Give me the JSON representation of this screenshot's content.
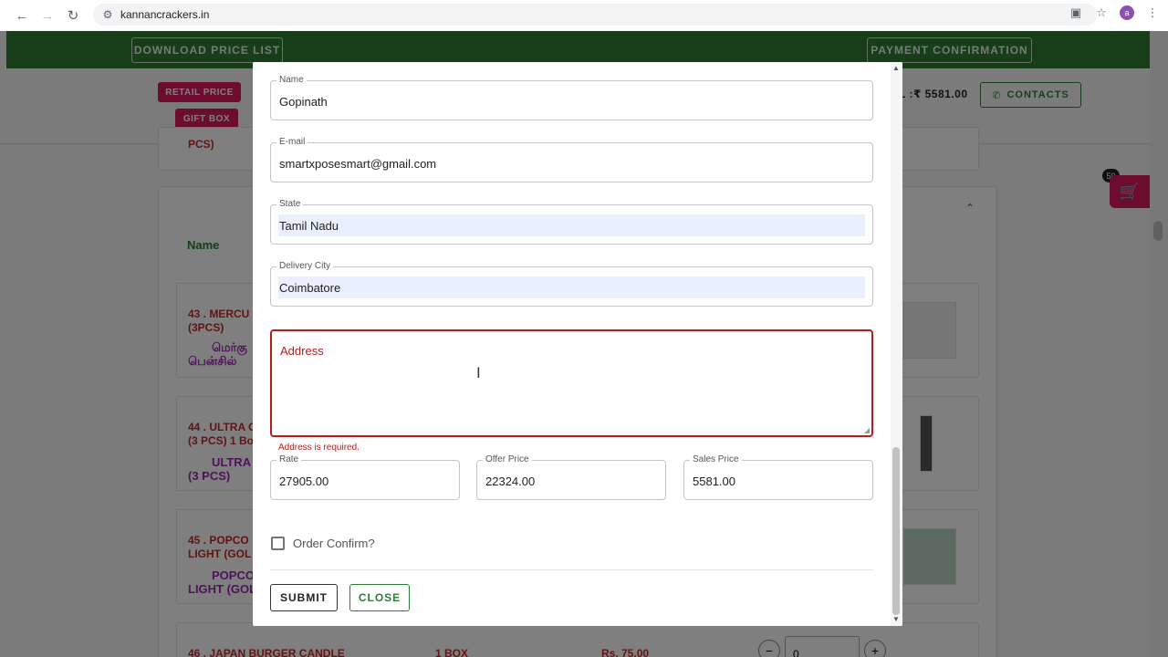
{
  "browser": {
    "url": "kannancrackers.in",
    "profile_initial": "a"
  },
  "page": {
    "download_price_list": "DOWNLOAD PRICE LIST",
    "payment_confirmation": "PAYMENT CONFIRMATION",
    "retail_price": "RETAIL PRICE",
    "gift_box": "GIFT BOX",
    "total_partial": "L :₹ 5581.00",
    "contacts": "CONTACTS",
    "column_name": "Name",
    "cart_count": "59",
    "partial_prev": "PCS)",
    "products": [
      {
        "name": "43 . MERCU\n(3PCS)",
        "tamil": "மெர்கு\nபென்சில்"
      },
      {
        "name": "44 . ULTRA C\n(3 PCS) 1 Bo",
        "tamil": "ULTRA C\n(3 PCS)"
      },
      {
        "name": "45 . POPCO\nLIGHT (GOL",
        "tamil": "POPCO\nLIGHT (GOL"
      }
    ],
    "row46": {
      "name": "46 . JAPAN BURGER CANDLE",
      "unit": "1 BOX",
      "price": "Rs. 75.00",
      "qty": "0"
    }
  },
  "dialog": {
    "name": {
      "label": "Name",
      "value": "Gopinath"
    },
    "email": {
      "label": "E-mail",
      "value": "smartxposesmart@gmail.com"
    },
    "state": {
      "label": "State",
      "value": "Tamil Nadu"
    },
    "city": {
      "label": "Delivery City",
      "value": "Coimbatore"
    },
    "address": {
      "placeholder": "Address",
      "error": "Address is required."
    },
    "rate": {
      "label": "Rate",
      "value": "27905.00"
    },
    "offer_price": {
      "label": "Offer Price",
      "value": "22324.00"
    },
    "sales_price": {
      "label": "Sales Price",
      "value": "5581.00"
    },
    "order_confirm": "Order Confirm?",
    "submit": "SUBMIT",
    "close": "CLOSE"
  },
  "colors": {
    "brand_green": "#2e7d32",
    "accent_pink": "#d81b60",
    "error_red": "#b71c1c"
  }
}
